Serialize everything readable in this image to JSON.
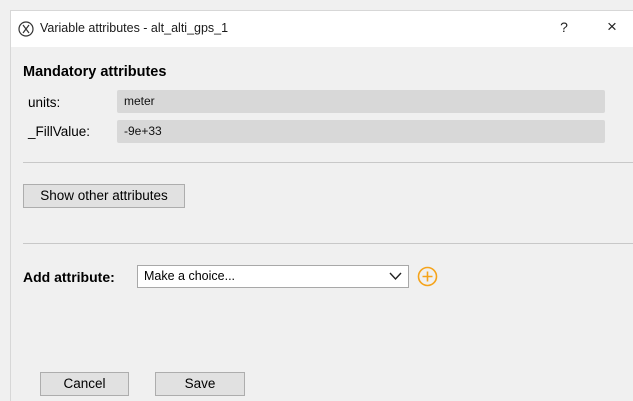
{
  "window": {
    "title": "Variable attributes - alt_alti_gps_1",
    "help_label": "?",
    "close_label": "×"
  },
  "mandatory": {
    "title": "Mandatory attributes",
    "attributes": [
      {
        "label": "units:",
        "value": "meter"
      },
      {
        "label": "_FillValue:",
        "value": "-9e+33"
      }
    ]
  },
  "show_other_label": "Show other attributes",
  "add_attribute": {
    "label": "Add attribute:",
    "selected": "Make a choice..."
  },
  "buttons": {
    "cancel": "Cancel",
    "save": "Save"
  },
  "colors": {
    "accent": "#f5a31a",
    "field_bg": "#d8d8d8",
    "window_bg": "#f0f0f0"
  },
  "icons": {
    "app": "app-logo-icon",
    "chevron": "chevron-down-icon",
    "add": "add-circle-icon"
  }
}
